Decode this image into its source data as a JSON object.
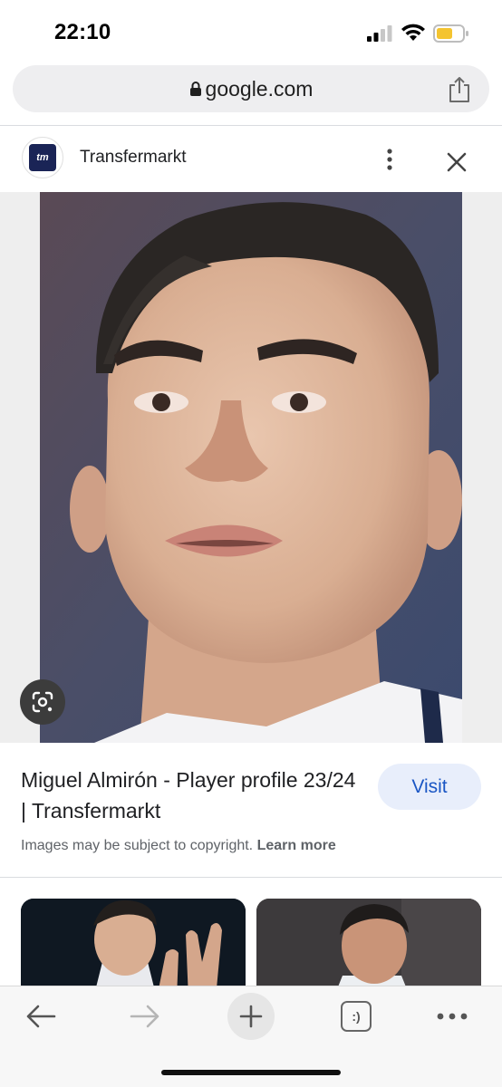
{
  "status_bar": {
    "time": "22:10",
    "icons": [
      "cellular-signal-icon",
      "wifi-icon",
      "battery-low-icon"
    ]
  },
  "browser": {
    "url": "google.com",
    "icons": [
      "lock-icon",
      "share-icon"
    ]
  },
  "source": {
    "logo_text": "tm",
    "name": "Transfermarkt",
    "icons": [
      "more-vertical-icon",
      "close-icon"
    ]
  },
  "viewer": {
    "image_subject": "player-headshot",
    "icons": [
      "google-lens-icon"
    ]
  },
  "result": {
    "title": "Miguel Almirón - Player profile 23/24 | Transfermarkt",
    "visit_label": "Visit",
    "copyright_text": "Images may be subject to copyright.",
    "learn_more_label": "Learn more"
  },
  "related_images": [
    "related-image-1",
    "related-image-2"
  ],
  "toolbar": {
    "icons": [
      "back-arrow-icon",
      "forward-arrow-icon",
      "new-tab-plus-icon",
      "tab-switcher-icon",
      "more-horizontal-icon"
    ],
    "tab_switcher_label": ":)"
  },
  "colors": {
    "accent": "#1a56c4",
    "visit_bg": "#e8eefb",
    "url_bar_bg": "#eeeef0",
    "logo_bg": "#1a2456"
  }
}
